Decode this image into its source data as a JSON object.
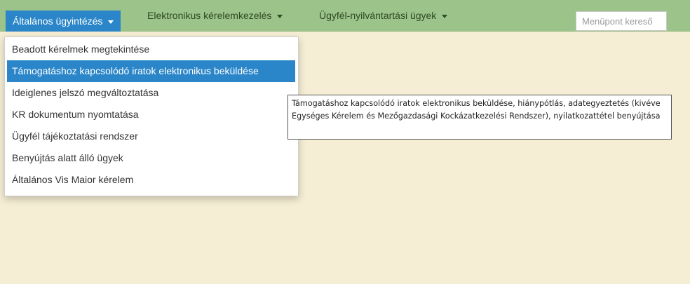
{
  "navbar": {
    "items": [
      {
        "label": "Általános ügyintézés"
      },
      {
        "label": "Elektronikus kérelemkezelés"
      },
      {
        "label": "Ügyfél-nyilvántartási ügyek"
      }
    ],
    "search": {
      "placeholder": "Menüpont kereső"
    }
  },
  "dropdown": {
    "items": [
      {
        "label": "Beadott kérelmek megtekintése"
      },
      {
        "label": "Támogatáshoz kapcsolódó iratok elektronikus beküldése"
      },
      {
        "label": "Ideiglenes jelszó megváltoztatása"
      },
      {
        "label": "KR dokumentum nyomtatása"
      },
      {
        "label": "Ügyfél tájékoztatási rendszer"
      },
      {
        "label": "Benyújtás alatt álló ügyek"
      },
      {
        "label": "Általános Vis Maior kérelem"
      }
    ]
  },
  "tooltip": {
    "text": "Támogatáshoz kapcsolódó iratok elektronikus beküldése, hiánypótlás, adategyeztetés (kivéve Egységes Kérelem és Mezőgazdasági Kockázatkezelési Rendszer), nyilatkozattétel benyújtása"
  },
  "colors": {
    "navbar_bg": "#9cc38a",
    "active_bg": "#2a86c8",
    "content_bg": "#f5eed4"
  }
}
